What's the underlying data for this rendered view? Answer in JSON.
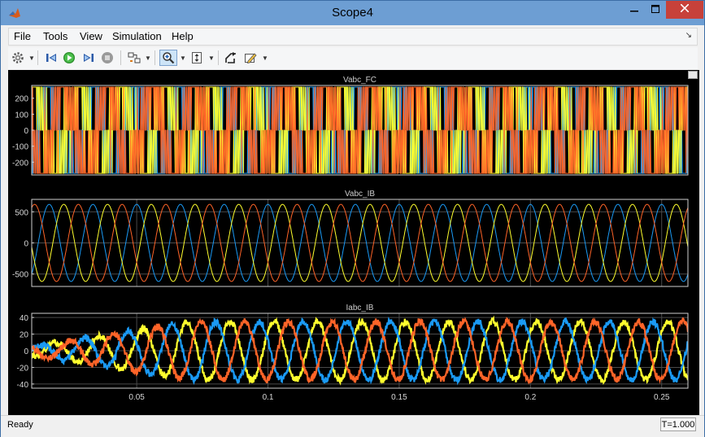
{
  "window": {
    "title": "Scope4"
  },
  "menu": [
    "File",
    "Tools",
    "View",
    "Simulation",
    "Help"
  ],
  "toolbar": {
    "icons": [
      "gear-icon",
      "step-back-icon",
      "run-icon",
      "step-forward-icon",
      "stop-icon",
      "highlight-block-icon",
      "zoom-in-icon",
      "zoom-y-icon",
      "restore-axes-icon",
      "edit-signals-icon"
    ],
    "zoom_pressed": true
  },
  "colors": {
    "yellow": "#ffff2e",
    "blue": "#1a9af5",
    "orange": "#ff6428",
    "grid": "#4a4a4a",
    "axes": "#d0d0d0"
  },
  "status": {
    "text": "Ready",
    "time": "T=1.000"
  },
  "chart_data": [
    {
      "type": "line",
      "title": "Vabc_FC",
      "ylim": [
        -280,
        280
      ],
      "yticks": [
        "200",
        "100",
        "0",
        "-100",
        "-200"
      ],
      "ytick_values": [
        200,
        100,
        0,
        -100,
        -200
      ],
      "xlim": [
        0.01,
        0.26
      ],
      "grid": false,
      "series": [
        {
          "color": "#ff6428",
          "description": "PWM line voltage, switching between about -270 and 270"
        },
        {
          "color": "#1a9af5",
          "description": "PWM line voltage"
        },
        {
          "color": "#ffff2e",
          "description": "PWM line voltage"
        }
      ],
      "fundamental_hz": 60,
      "amplitude": 270
    },
    {
      "type": "line",
      "title": "Vabc_IB",
      "ylim": [
        -700,
        700
      ],
      "yticks": [
        "500",
        "0",
        "-500"
      ],
      "ytick_values": [
        500,
        0,
        -500
      ],
      "xlim": [
        0.01,
        0.26
      ],
      "grid": true,
      "series": [
        {
          "color": "#1a9af5",
          "amplitude": 620,
          "frequency_hz": 60,
          "phase_deg": 90
        },
        {
          "color": "#ffff2e",
          "amplitude": 620,
          "frequency_hz": 60,
          "phase_deg": -30
        },
        {
          "color": "#ff6428",
          "amplitude": 620,
          "frequency_hz": 60,
          "phase_deg": 210
        }
      ]
    },
    {
      "type": "line",
      "title": "Iabc_IB",
      "ylim": [
        -45,
        45
      ],
      "yticks": [
        "40",
        "20",
        "0",
        "-20",
        "-40"
      ],
      "ytick_values": [
        40,
        20,
        0,
        -20,
        -40
      ],
      "xlim": [
        0.01,
        0.26
      ],
      "xticks": [
        "0.05",
        "0.1",
        "0.15",
        "0.2",
        "0.25"
      ],
      "xtick_values": [
        0.05,
        0.1,
        0.15,
        0.2,
        0.25
      ],
      "grid": true,
      "series": [
        {
          "color": "#ffff2e",
          "amplitude": 35,
          "frequency_hz": 60,
          "phase_deg": 40
        },
        {
          "color": "#1a9af5",
          "amplitude": 35,
          "frequency_hz": 60,
          "phase_deg": 160
        },
        {
          "color": "#ff6428",
          "amplitude": 35,
          "frequency_hz": 60,
          "phase_deg": 280
        }
      ],
      "ramp_up_to_s": 0.07,
      "noise_amplitude": 4
    }
  ]
}
